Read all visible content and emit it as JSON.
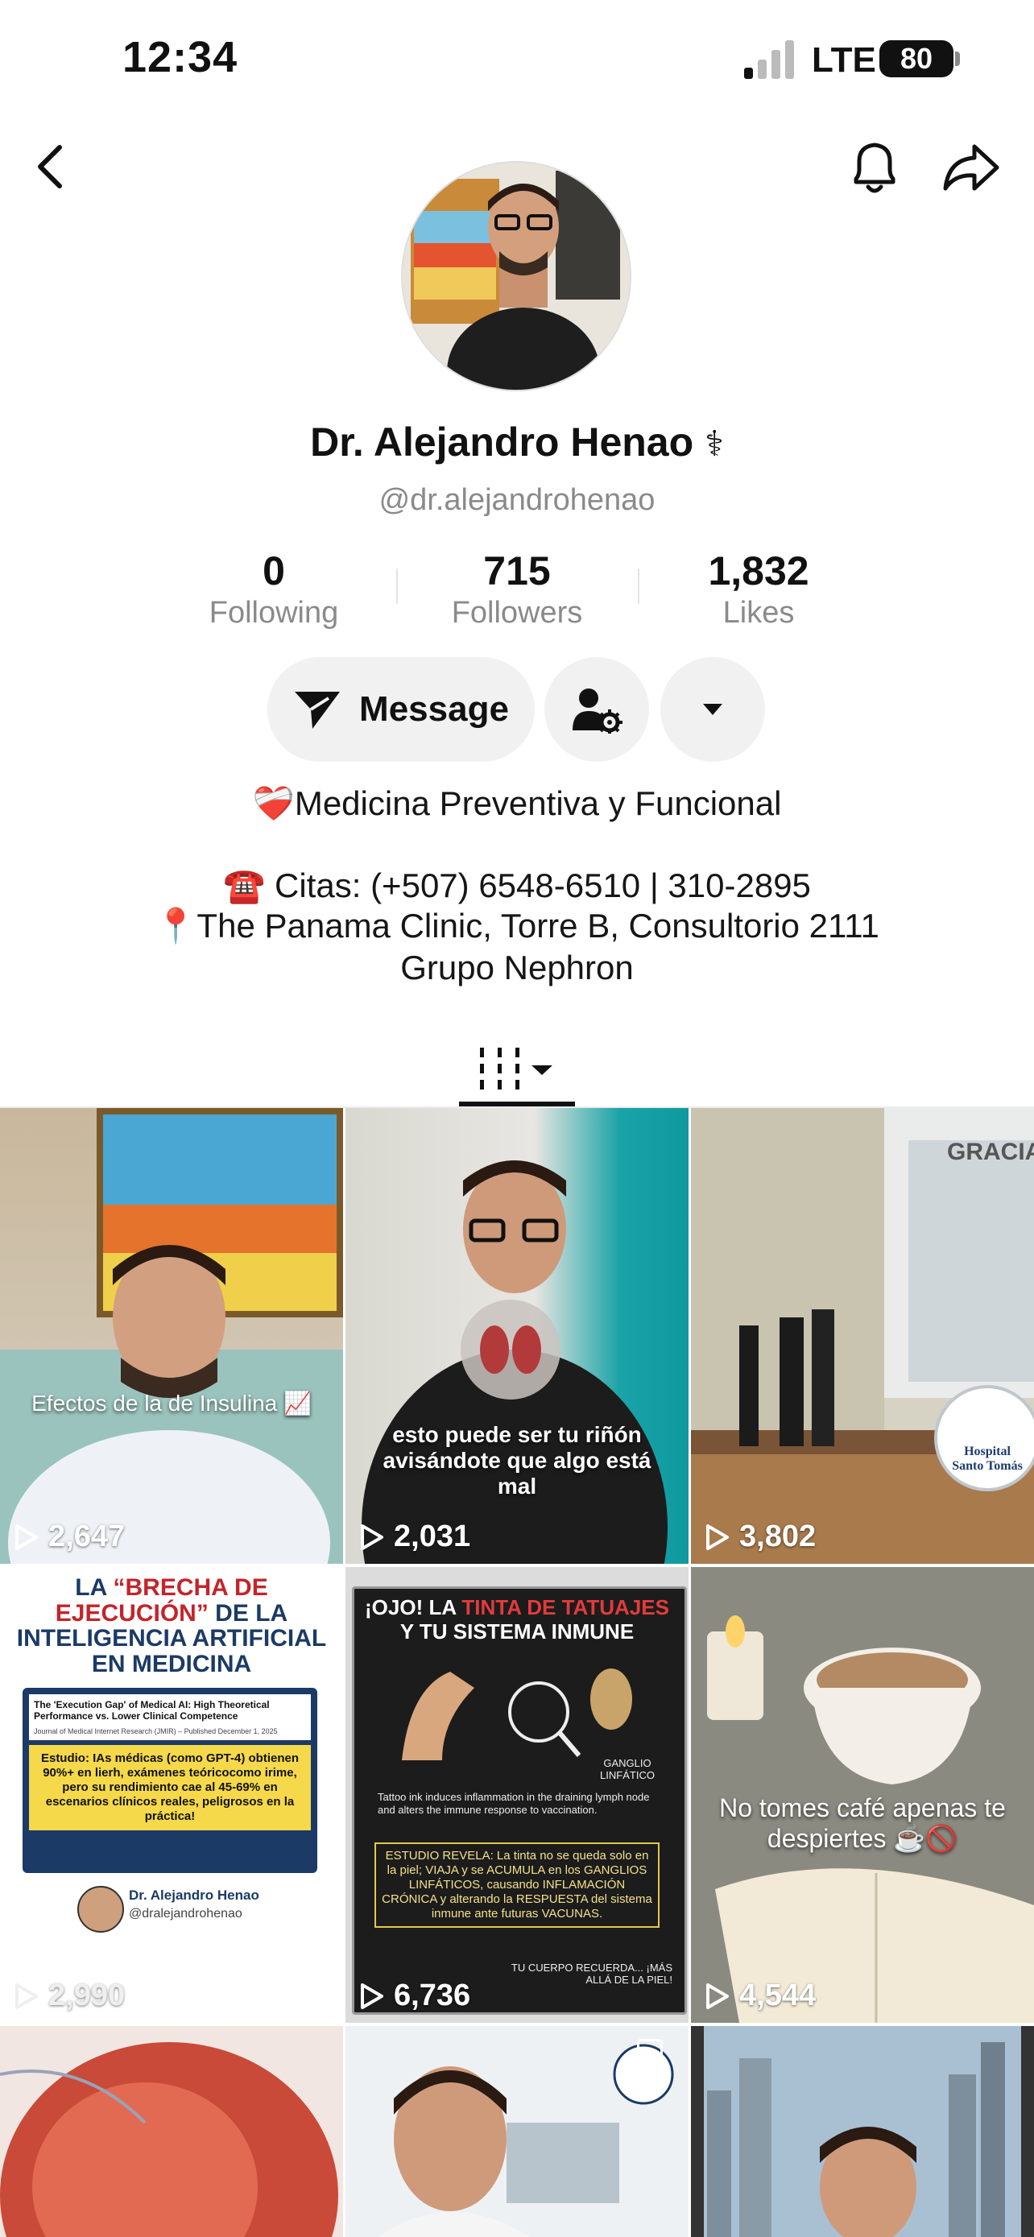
{
  "status": {
    "time": "12:34",
    "network": "LTE",
    "battery": "80"
  },
  "profile": {
    "name": "Dr. Alejandro Henao",
    "name_symbol": "⚕",
    "handle": "@dr.alejandrohenao",
    "stats": [
      {
        "value": "0",
        "label": "Following"
      },
      {
        "value": "715",
        "label": "Followers"
      },
      {
        "value": "1,832",
        "label": "Likes"
      }
    ],
    "message_label": "Message",
    "bio": [
      "❤️‍🩹Medicina Preventiva y Funcional",
      "☎️ Citas: (+507) 6548-6510 | 310-2895",
      "📍The Panama Clinic, Torre B, Consultorio 2111",
      "Grupo Nephron"
    ]
  },
  "videos": [
    {
      "views": "2,647",
      "caption": "Efectos de la de Insulina 📈"
    },
    {
      "views": "2,031",
      "caption": "esto puede ser tu riñón avisándote que algo está mal"
    },
    {
      "views": "3,802",
      "overlay_text": "GRACIA",
      "sign": "Hospital Santo Tomás"
    },
    {
      "views": "2,990",
      "headline_1": "LA ",
      "headline_quote": "“BRECHA DE EJECUCIÓN”",
      "headline_2": " DE LA INTELIGENCIA ARTIFICIAL EN MEDICINA",
      "paper_title": "The 'Execution Gap' of Medical AI: High Theoretical Performance vs. Lower Clinical Competence",
      "paper_source": "Journal of Medical Internet Research (JMIR) – Published December 1, 2025",
      "study_text": "Estudio: IAs médicas (como GPT-4) obtienen 90%+ en lierh, exámenes teóricocomo irime, pero su rendimiento cae al 45-69% en escenarios clínicos reales, peligrosos en la práctica!",
      "author": "Dr. Alejandro Henao",
      "author_handle": "@dralejandrohenao"
    },
    {
      "views": "6,736",
      "headline_1": "¡OJO! LA ",
      "headline_red": "TINTA DE TATUAJES",
      "headline_2": "Y TU SISTEMA INMUNE",
      "gland_label": "GANGLIO LINFÁTICO",
      "paper": "Tattoo ink induces inflammation in the draining lymph node and alters the immune response to vaccination.",
      "reveal": "ESTUDIO REVELA: La tinta no se queda solo en la piel; VIAJA y se ACUMULA en los GANGLIOS LINFÁTICOS, causando INFLAMACIÓN CRÓNICA y alterando la RESPUESTA del sistema inmune ante futuras VACUNAS.",
      "footer": "TU CUERPO RECUERDA... ¡MÁS ALLÁ DE LA PIEL!"
    },
    {
      "views": "4,544",
      "caption": "No tomes café apenas te despiertes ☕🚫"
    },
    {
      "views": ""
    },
    {
      "views": ""
    },
    {
      "views": ""
    }
  ]
}
